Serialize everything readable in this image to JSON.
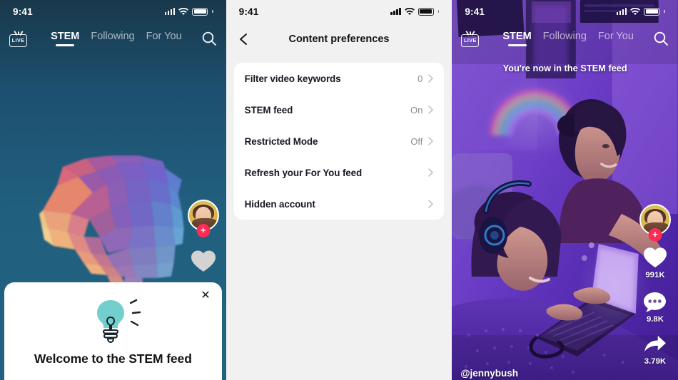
{
  "status_bar": {
    "time": "9:41",
    "signal_icon": "cellular-bars-icon",
    "wifi_icon": "wifi-icon",
    "battery_icon": "battery-icon"
  },
  "panel_feed_left": {
    "live_label": "LIVE",
    "tabs": [
      {
        "label": "STEM",
        "active": true
      },
      {
        "label": "Following",
        "active": false
      },
      {
        "label": "For You",
        "active": false
      }
    ],
    "search_icon": "search-icon",
    "avatar_name": "avatar",
    "follow_badge": "+",
    "like_icon": "heart-icon",
    "welcome_card": {
      "close_icon": "close-icon",
      "bulb_icon": "lightbulb-icon",
      "title": "Welcome to the STEM feed",
      "bulb_color": "#72cfcd"
    },
    "background_colors": [
      "#19384b",
      "#215f7f"
    ]
  },
  "panel_settings": {
    "back_icon": "chevron-left-icon",
    "title": "Content preferences",
    "rows": [
      {
        "label": "Filter video keywords",
        "value": "0",
        "chevron": "chevron-right-icon"
      },
      {
        "label": "STEM feed",
        "value": "On",
        "chevron": "chevron-right-icon"
      },
      {
        "label": "Restricted Mode",
        "value": "Off",
        "chevron": "chevron-right-icon"
      },
      {
        "label": "Refresh your For You feed",
        "value": "",
        "chevron": "chevron-right-icon"
      },
      {
        "label": "Hidden account",
        "value": "",
        "chevron": "chevron-right-icon"
      }
    ],
    "background_color": "#f1f1f1",
    "card_color": "#ffffff"
  },
  "panel_feed_right": {
    "live_label": "LIVE",
    "tabs": [
      {
        "label": "STEM",
        "active": true
      },
      {
        "label": "Following",
        "active": false
      },
      {
        "label": "For You",
        "active": false
      }
    ],
    "search_icon": "search-icon",
    "toast": "You're now in the STEM feed",
    "username": "@jennybush",
    "follow_badge": "+",
    "actions": [
      {
        "icon": "heart-icon",
        "count": "991K"
      },
      {
        "icon": "comment-icon",
        "count": "9.8K"
      },
      {
        "icon": "share-icon",
        "count": "3.79K"
      }
    ],
    "accent_color": "#fe2c55"
  }
}
